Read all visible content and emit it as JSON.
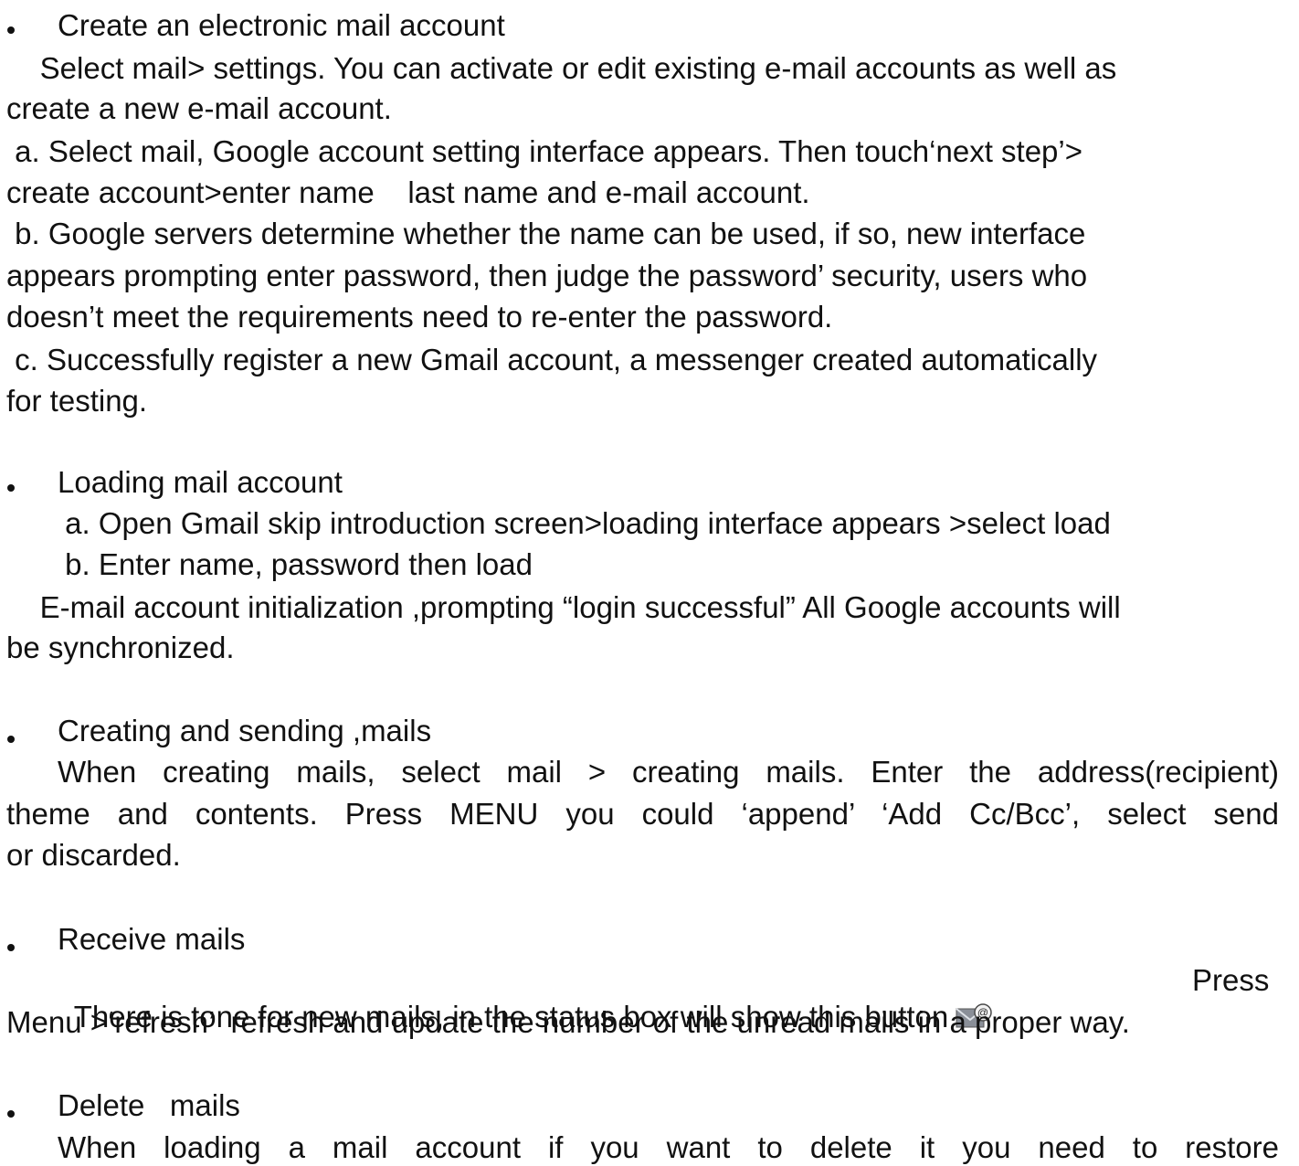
{
  "sections": {
    "create_account": {
      "heading": "Create an electronic mail account",
      "lines": [
        "    Select mail> settings. You can activate or edit existing e-mail accounts as well as",
        "create a new e-mail account.",
        " a. Select mail, Google account setting interface appears. Then touch‘next step’>",
        "create account>enter name    last name and e-mail account.",
        " b. Google servers determine whether the name can be used, if so, new interface",
        "appears prompting enter password, then judge the password’ security, users who",
        "doesn’t meet the requirements need to re-enter the password.",
        " c. Successfully register a new Gmail account, a messenger created automatically",
        "for testing."
      ]
    },
    "loading_account": {
      "heading": "Loading mail account",
      "lines": [
        "       a. Open Gmail skip introduction screen>loading interface appears >select load",
        "       b. Enter name, password then load",
        "    E-mail account initialization ,prompting “login successful” All Google accounts will",
        "be synchronized."
      ]
    },
    "creating_sending": {
      "heading": "Creating and sending ,mails",
      "lines": [
        "When creating mails, select mail > creating mails. Enter the address(recipient)",
        "theme and contents. Press MENU you could ‘append’  ‘Add Cc/Bcc’,  select send",
        "or discarded."
      ]
    },
    "receive": {
      "heading": "Receive mails",
      "lines": [
        "There is tone for new mails, in the status box will show this button",
        "Press",
        "Menu >‘refresh’  refresh and update the number of the unread mails in a proper way."
      ],
      "icon": "mail-at-icon"
    },
    "delete": {
      "heading": "Delete   mails",
      "lines": [
        "When loading a mail account  if you want to delete it  you need to restore"
      ]
    }
  }
}
